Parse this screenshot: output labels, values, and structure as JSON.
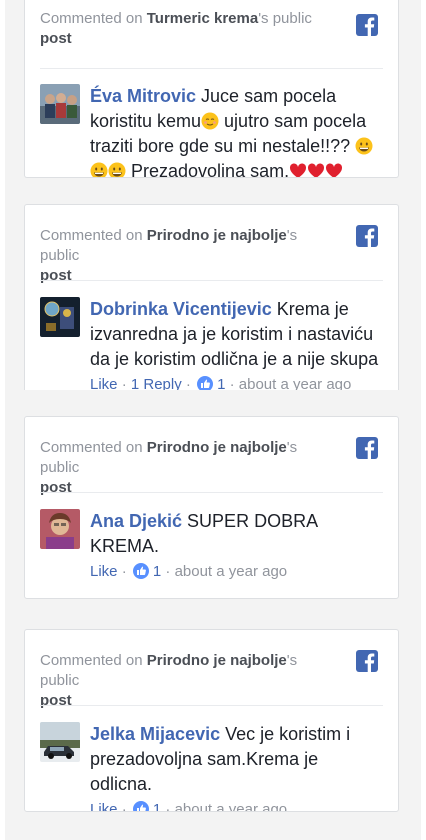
{
  "cards": [
    {
      "prefix": "Commented on ",
      "page": "Turmeric krema",
      "suffix": "'s public",
      "post": "post",
      "author": "Éva Mitrovic",
      "text_a": " Juce sam pocela koristitu kemu",
      "text_b": " ujutro sam pocela traziti bore gde su mi nestale!!?? ",
      "text_c": " Prezadovoljna sam."
    },
    {
      "prefix": "Commented on ",
      "page": "Prirodno je najbolje",
      "suffix": "'s public",
      "post": "post",
      "author": "Dobrinka Vicentijevic",
      "text": " Krema je izvanredna ja je koristim i nastaviću da je koristim odlična je a nije skupa",
      "like": "Like",
      "sep1": " · ",
      "reply": "1 Reply",
      "sep2": " · ",
      "likes": "1",
      "sep3": " · ",
      "time": "about a year ago"
    },
    {
      "prefix": "Commented on ",
      "page": "Prirodno je najbolje",
      "suffix": "'s public",
      "post": "post",
      "author": "Ana Djekić",
      "text": " SUPER DOBRA KREMA.",
      "like": "Like",
      "sep1": " · ",
      "likes": "1",
      "sep2": " · ",
      "time": "about a year ago"
    },
    {
      "prefix": "Commented on ",
      "page": "Prirodno je najbolje",
      "suffix": "'s public",
      "post": "post",
      "author": "Jelka Mijacevic",
      "text": " Vec je koristim i prezadovoljna sam.Krema je odlicna.",
      "like": "Like",
      "sep1": " · ",
      "likes": "1",
      "sep2": " · ",
      "time": "about a year ago"
    }
  ],
  "colors": {
    "fb_blue": "#4267b2",
    "like_blue": "#5890ff",
    "muted": "#90949c"
  },
  "icons": [
    "facebook-icon",
    "like-thumb-icon",
    "grinning-emoji",
    "relieved-emoji",
    "heart-emoji"
  ]
}
